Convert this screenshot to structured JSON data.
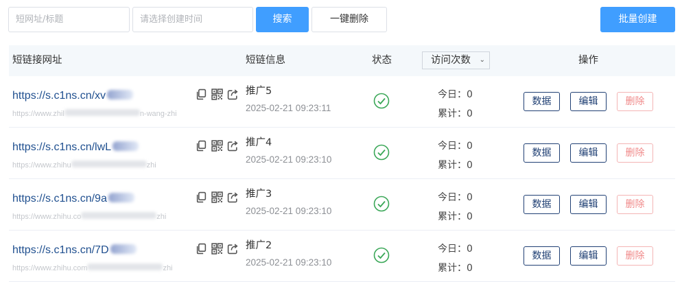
{
  "search": {
    "url_placeholder": "短网址/标题",
    "date_placeholder": "请选择创建时间",
    "search_label": "搜索",
    "delete_all_label": "一键删除",
    "batch_create_label": "批量创建"
  },
  "table": {
    "headers": {
      "short_url": "短链接网址",
      "info": "短链信息",
      "status": "状态",
      "visits": "访问次数",
      "actions": "操作"
    },
    "sort_chevron": "⌄",
    "rows": [
      {
        "short_url": "https://s.c1ns.cn/xv",
        "original_url_start": "https://www.zhil",
        "original_url_end": "n-wang-zhi",
        "name": "推广5",
        "created": "2025-02-21 09:23:11",
        "today": "今日：0",
        "total": "累计：0"
      },
      {
        "short_url": "https://s.c1ns.cn/lwL",
        "original_url_start": "https://www.zhihu",
        "original_url_end": "zhi",
        "name": "推广4",
        "created": "2025-02-21 09:23:10",
        "today": "今日：0",
        "total": "累计：0"
      },
      {
        "short_url": "https://s.c1ns.cn/9a",
        "original_url_start": "https://www.zhihu.co",
        "original_url_end": "zhi",
        "name": "推广3",
        "created": "2025-02-21 09:23:10",
        "today": "今日：0",
        "total": "累计：0"
      },
      {
        "short_url": "https://s.c1ns.cn/7D",
        "original_url_start": "https://www.zhihu.com",
        "original_url_end": "zhi",
        "name": "推广2",
        "created": "2025-02-21 09:23:10",
        "today": "今日：0",
        "total": "累计：0"
      }
    ],
    "actions": {
      "data_label": "数据",
      "edit_label": "编辑",
      "delete_label": "删除"
    }
  },
  "colors": {
    "primary": "#409eff",
    "status_ok": "#3aa757",
    "danger": "#f08a8a",
    "link": "#1f4f8f"
  },
  "icons": [
    "copy-icon",
    "qrcode-icon",
    "share-icon",
    "check-circle-icon"
  ]
}
